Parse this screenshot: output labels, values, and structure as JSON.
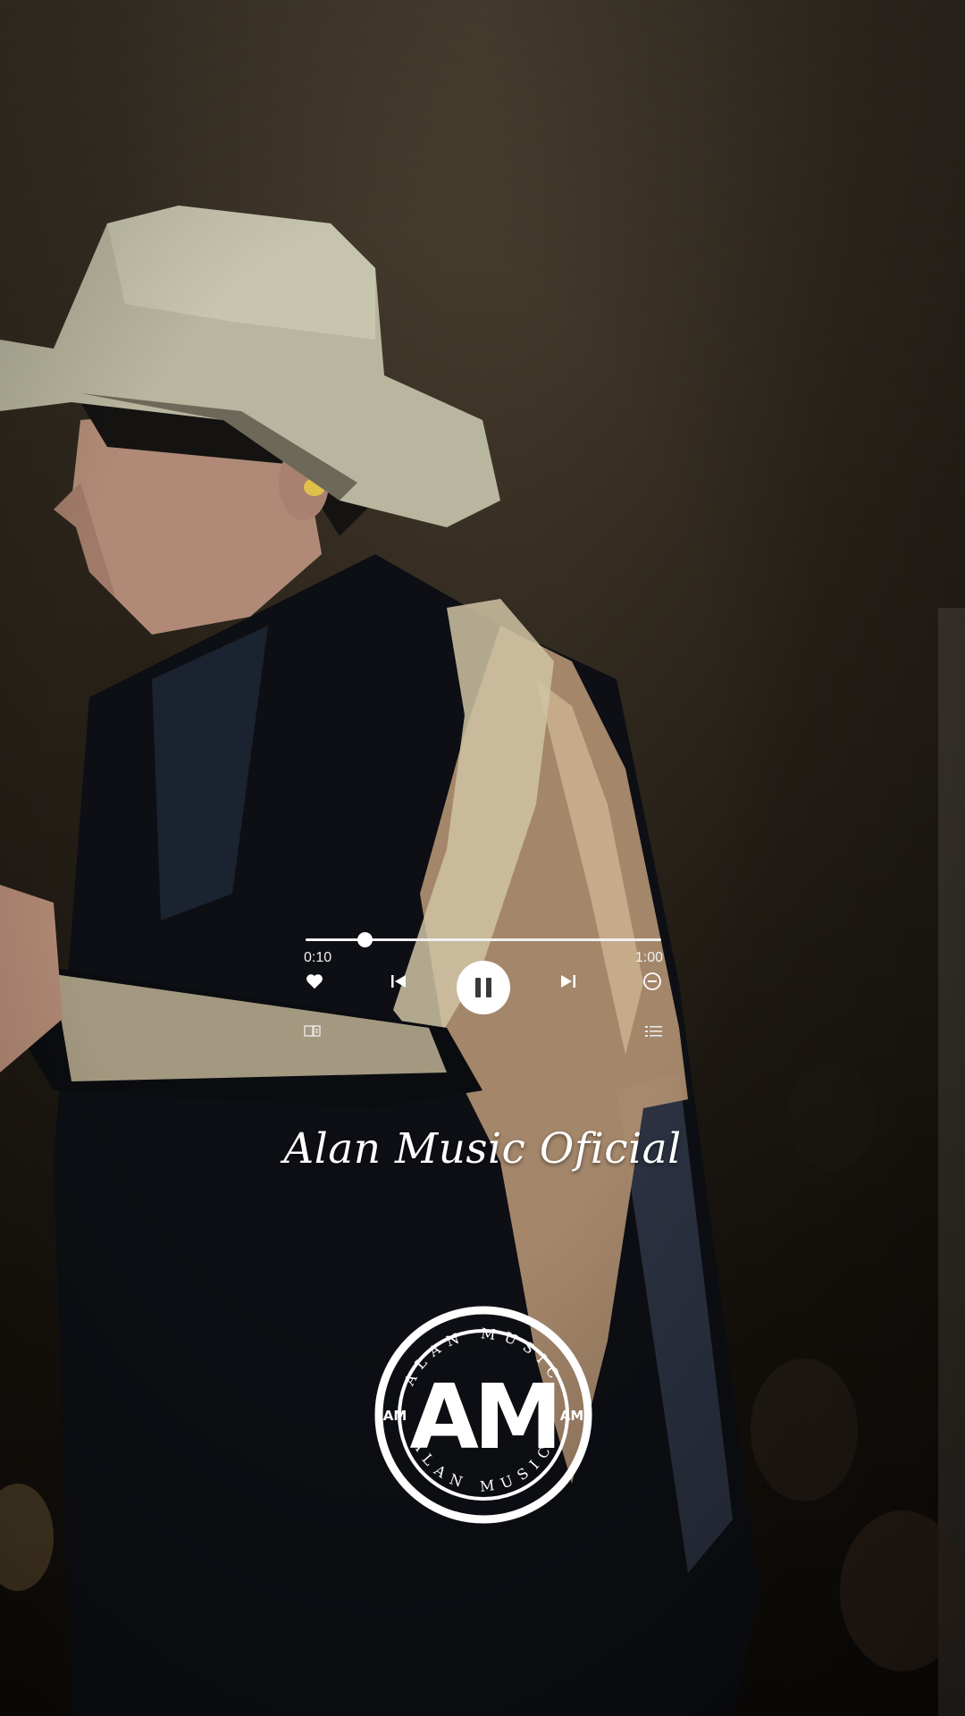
{
  "player": {
    "elapsed": "0:10",
    "total": "1:00",
    "progress_fraction": 0.167,
    "is_playing": true,
    "icons": {
      "like": "heart-icon",
      "previous": "skip-previous-icon",
      "pause": "pause-icon",
      "next": "skip-next-icon",
      "remove": "minus-circle-icon",
      "lyrics": "lyrics-icon",
      "queue": "playlist-icon"
    }
  },
  "watermark": {
    "signature": "Alan Music Oficial",
    "logo_ring_text": "ALAN MUSIC",
    "logo_monogram": "AM",
    "logo_side_mark": "AM"
  },
  "colors": {
    "foreground": "#ffffff",
    "background_dark": "#1d1710"
  }
}
